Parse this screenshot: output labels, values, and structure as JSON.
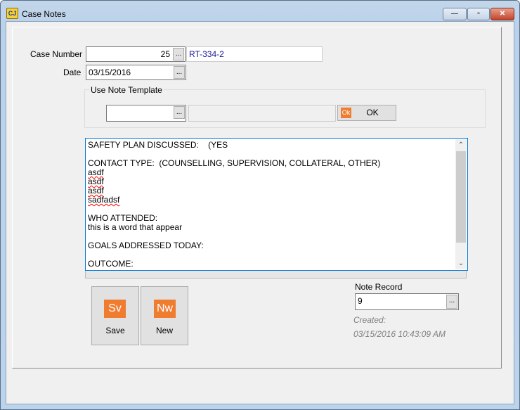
{
  "window": {
    "title": "Case Notes",
    "icon": "CJ",
    "minimize": "—",
    "maximize": "▫",
    "close": "✕"
  },
  "form": {
    "case_number_label": "Case Number",
    "case_number": "25",
    "case_code": "RT-334-2",
    "date_label": "Date",
    "date": "03/15/2016",
    "ellipsis": "...",
    "template_group_label": "Use Note Template",
    "template_value": "",
    "template_desc": "",
    "ok_icon": "Ok",
    "ok_label": "OK",
    "notes": [
      {
        "text": "SAFETY PLAN DISCUSSED:    (YES",
        "misspelled": false
      },
      {
        "text": "",
        "misspelled": false
      },
      {
        "text": "CONTACT TYPE:  (COUNSELLING, SUPERVISION, COLLATERAL, OTHER)",
        "misspelled": false
      },
      {
        "text": "asdf",
        "misspelled": true
      },
      {
        "text": "asdf",
        "misspelled": true
      },
      {
        "text": "asdf",
        "misspelled": true
      },
      {
        "text": "sadfadsf",
        "misspelled": true
      },
      {
        "text": "",
        "misspelled": false
      },
      {
        "text": "WHO ATTENDED:",
        "misspelled": false
      },
      {
        "text": "this is a word that appear",
        "misspelled": false
      },
      {
        "text": "",
        "misspelled": false
      },
      {
        "text": "GOALS ADDRESSED TODAY:",
        "misspelled": false
      },
      {
        "text": "",
        "misspelled": false
      },
      {
        "text": "OUTCOME:",
        "misspelled": false
      }
    ],
    "scroll_up": "⌃",
    "scroll_down": "⌄"
  },
  "actions": {
    "save_icon": "Sv",
    "save_label": "Save",
    "new_icon": "Nw",
    "new_label": "New"
  },
  "record": {
    "label": "Note Record",
    "value": "9",
    "created_label": "Created:",
    "created_value": "03/15/2016 10:43:09 AM"
  },
  "colors": {
    "accent": "#f07c30",
    "focus": "#0078d7"
  }
}
